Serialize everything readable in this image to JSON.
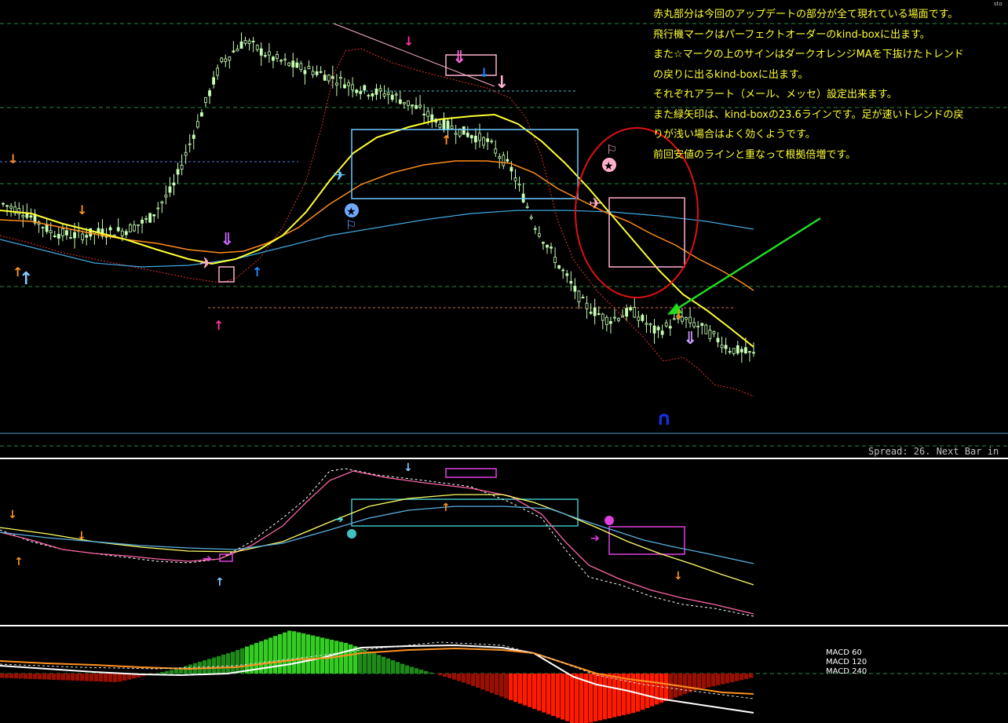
{
  "annotation_lines": [
    "赤丸部分は今回のアップデートの部分が全て現れている場面です。",
    "飛行機マークはパーフェクトオーダーのkind-boxに出ます。",
    "また☆マークの上のサインはダークオレンジMAを下抜けたトレンド",
    "の戻りに出るkind-boxに出ます。",
    "それぞれアラート（メール、メッセ）設定出来ます。",
    "また緑矢印は、kind-boxの23.6ラインです。足が速いトレンドの戻",
    "りが浅い場合はよく効くようです。",
    "前回安値のラインと重なって根拠倍増です。"
  ],
  "status": {
    "spread_text": "Spread: 26. Next Bar in",
    "corner_text": "sto"
  },
  "macd_labels": [
    "MACD 60",
    "MACD 120",
    "MACD 240"
  ],
  "colors": {
    "background": "#000000",
    "candle": "#c8ffb4",
    "ma_yellow": "#ffff33",
    "ma_darkorange": "#ff8c1a",
    "ma_blue": "#3fa9e0",
    "trend_dashed_red": "#e03030",
    "kind_box_blue": "#6fc8ff",
    "kind_box_pink": "#ffb0d0",
    "kind_box_magenta": "#e040e0",
    "highlight_circle": "#e01010",
    "green_arrow": "#22dd22",
    "hist_green": "#33cc22",
    "hist_red": "#ff1a00",
    "grid_dashed": "#1f8f3f",
    "arrow_orange": "#ff9020",
    "arrow_pink": "#ff3399",
    "arrow_skyblue": "#88ccff",
    "arrow_blue": "#2288ff",
    "arrow_violet": "#cc66ff"
  },
  "chart_data": [
    {
      "type": "candlestick",
      "panel": "price",
      "title": "",
      "series": [
        {
          "name": "",
          "kind": "close",
          "values": [
            1.0,
            0.7,
            0.1,
            0.0,
            0.1,
            0.15,
            0.5,
            1.5,
            3.5,
            5.5,
            6.2,
            5.7,
            5.4,
            5.2,
            4.9,
            4.6,
            4.5,
            4.1,
            3.6,
            3.3,
            3.0,
            2.1,
            0.3,
            -1.0,
            -2.2,
            -2.7,
            -2.4,
            -3.1,
            -2.6,
            -3.0,
            -3.6,
            -3.8
          ]
        }
      ],
      "trend_signals": [
        "airplane",
        "airplane",
        "airplane",
        "star",
        "star",
        "u-turn"
      ]
    },
    {
      "type": "line",
      "panel": "oscillator",
      "title": "",
      "series": [
        {
          "name": "",
          "color": "pink",
          "values": [
            0.55,
            0.5,
            0.4,
            0.3,
            0.28,
            0.3,
            0.45,
            0.9,
            1.6,
            2.05,
            1.95,
            1.9,
            1.85,
            1.82,
            1.78,
            1.72,
            1.45,
            0.6,
            -0.2,
            -0.45,
            -0.6,
            -0.9
          ]
        },
        {
          "name": "",
          "color": "yellow",
          "values": [
            0.6,
            0.58,
            0.55,
            0.45,
            0.38,
            0.35,
            0.6,
            1.1,
            1.45,
            1.6,
            1.7,
            1.72,
            1.68,
            1.55,
            1.2,
            0.8,
            0.4,
            0.2,
            0.05
          ]
        },
        {
          "name": "",
          "color": "blue",
          "values": [
            0.6,
            0.58,
            0.55,
            0.5,
            0.45,
            0.42,
            0.6,
            1.0,
            1.3,
            1.45,
            1.5,
            1.48,
            1.4,
            1.2,
            0.9,
            0.7,
            0.55
          ]
        }
      ]
    },
    {
      "type": "bar",
      "panel": "macd",
      "title": "",
      "series": [
        {
          "name": "MACD 60",
          "color": "white",
          "values": [
            0.0,
            -0.05,
            -0.1,
            -0.05,
            0.2,
            0.6,
            0.9,
            0.95,
            0.9,
            0.8,
            0.5,
            -0.3,
            -0.7,
            -0.9
          ]
        },
        {
          "name": "MACD 120",
          "color": "orange",
          "values": [
            0.1,
            0.05,
            0.0,
            0.0,
            0.15,
            0.45,
            0.75,
            0.8,
            0.78,
            0.7,
            0.5,
            0.1,
            -0.3,
            -0.5
          ]
        },
        {
          "name": "MACD 240",
          "color": "histogram",
          "values": [
            -0.1,
            -0.15,
            -0.2,
            0.1,
            0.5,
            1.0,
            0.7,
            0.2,
            -0.2,
            -0.7,
            -1.2,
            -0.9,
            -0.4,
            -0.1
          ]
        }
      ]
    }
  ]
}
